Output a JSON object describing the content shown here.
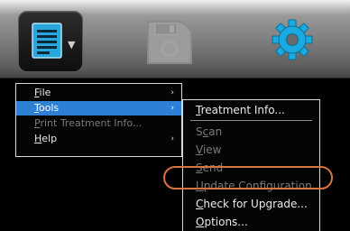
{
  "toolbar": {
    "buttons": [
      {
        "icon": "document-menu-icon"
      },
      {
        "icon": "save-icon",
        "state": "disabled"
      },
      {
        "icon": "gear-icon"
      }
    ]
  },
  "main_menu": {
    "items": [
      {
        "label_key": "F",
        "label_rest": "ile",
        "state": "normal",
        "submenu": true
      },
      {
        "label_key": "T",
        "label_rest": "ools",
        "state": "selected",
        "submenu": true
      },
      {
        "label_key": "P",
        "label_rest": "rint Treatment Info...",
        "state": "disabled",
        "submenu": false
      },
      {
        "label_key": "H",
        "label_rest": "elp",
        "state": "normal",
        "submenu": true
      }
    ],
    "submenu_arrow": "›"
  },
  "tools_menu": {
    "items": [
      {
        "label_key": "T",
        "label_rest": "reatment Info...",
        "state": "normal"
      },
      {
        "label_pre": "S",
        "label_key": "c",
        "label_rest": "an",
        "state": "disabled"
      },
      {
        "label_key": "V",
        "label_rest": "iew",
        "state": "disabled"
      },
      {
        "label_key": "S",
        "label_rest": "end",
        "state": "disabled"
      },
      {
        "label_key": "U",
        "label_rest": "pdate Configuration",
        "state": "disabled",
        "highlighted": true
      },
      {
        "label_key": "C",
        "label_rest": "heck for Upgrade...",
        "state": "normal"
      },
      {
        "label_key": "O",
        "label_rest": "ptions...",
        "state": "normal"
      }
    ]
  },
  "colors": {
    "menu_bg": "#050505",
    "menu_text": "#eaeaea",
    "selected_bg": "#2e7fd6",
    "disabled_text": "#7a7a7a",
    "highlight_ring": "#d9733e",
    "gear_blue": "#1aa9e0",
    "document_blue": "#29a6dc"
  }
}
